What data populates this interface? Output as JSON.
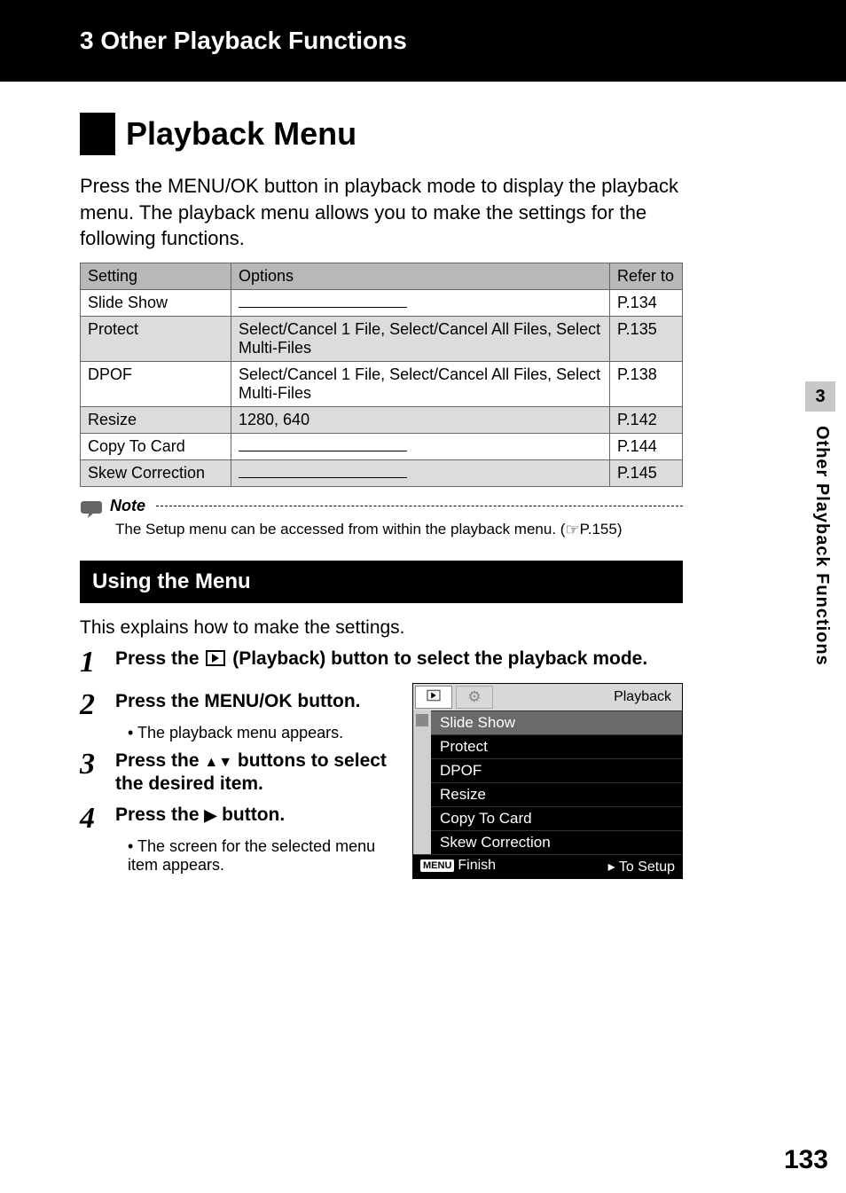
{
  "header": {
    "title": "3  Other Playback Functions"
  },
  "title": "Playback Menu",
  "intro": "Press the MENU/OK button in playback mode to display the playback menu. The playback menu allows you to make the settings for the following functions.",
  "table": {
    "headers": {
      "setting": "Setting",
      "options": "Options",
      "refer": "Refer to"
    },
    "rows": [
      {
        "setting": "Slide Show",
        "options": "",
        "ref": "P.134",
        "dash": true
      },
      {
        "setting": "Protect",
        "options": "Select/Cancel 1 File, Select/Cancel All Files, Select Multi-Files",
        "ref": "P.135"
      },
      {
        "setting": "DPOF",
        "options": "Select/Cancel 1 File, Select/Cancel All Files, Select Multi-Files",
        "ref": "P.138"
      },
      {
        "setting": "Resize",
        "options": "1280, 640",
        "ref": "P.142"
      },
      {
        "setting": "Copy To Card",
        "options": "",
        "ref": "P.144",
        "dash": true
      },
      {
        "setting": "Skew Correction",
        "options": "",
        "ref": "P.145",
        "dash": true
      }
    ]
  },
  "note": {
    "label": "Note",
    "text_before": "The Setup menu can be accessed from within the playback menu. (",
    "text_after": "P.155)"
  },
  "subhead": "Using the Menu",
  "sub_intro": "This explains how to make the settings.",
  "steps": {
    "s1_a": "Press the ",
    "s1_b": " (Playback) button to select the playback mode.",
    "s2": "Press the MENU/OK button.",
    "s2_bullet": "The playback menu appears.",
    "s3_a": "Press the ",
    "s3_b": " buttons to select the desired item.",
    "s4_a": "Press the ",
    "s4_b": " button.",
    "s4_bullet": "The screen for the selected menu item appears."
  },
  "playback_screen": {
    "head_label": "Playback",
    "items": [
      "Slide Show",
      "Protect",
      "DPOF",
      "Resize",
      "Copy To Card",
      "Skew Correction"
    ],
    "foot_left_badge": "MENU",
    "foot_left": "Finish",
    "foot_right": "▸ To Setup"
  },
  "side": {
    "num": "3",
    "text": "Other Playback Functions"
  },
  "page_number": "133"
}
